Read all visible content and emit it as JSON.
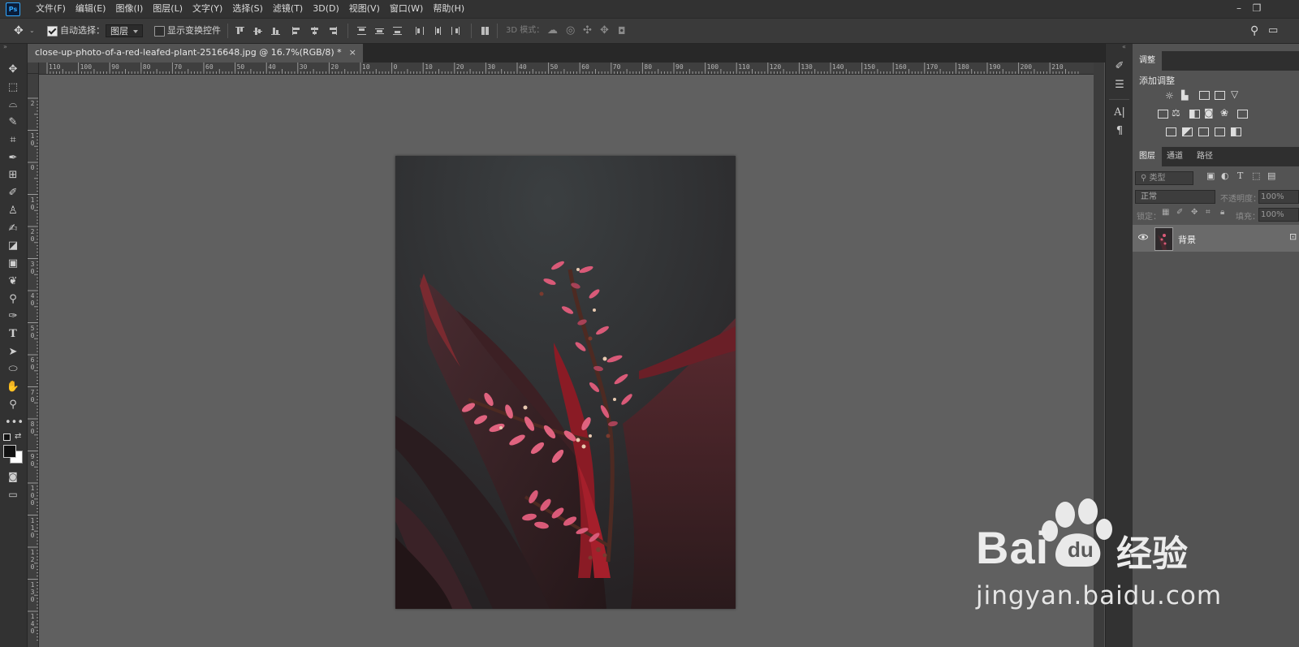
{
  "menubar": {
    "app_logo": "Ps",
    "items": [
      "文件(F)",
      "编辑(E)",
      "图像(I)",
      "图层(L)",
      "文字(Y)",
      "选择(S)",
      "滤镜(T)",
      "3D(D)",
      "视图(V)",
      "窗口(W)",
      "帮助(H)"
    ]
  },
  "options_bar": {
    "auto_select_label": "自动选择：",
    "auto_select_checked": true,
    "auto_select_target": "图层",
    "show_transform_label": "显示变换控件",
    "show_transform_checked": false,
    "mode_3d_label": "3D 模式："
  },
  "document": {
    "tab_title": "close-up-photo-of-a-red-leafed-plant-2516648.jpg @ 16.7%(RGB/8) *",
    "close_glyph": "×"
  },
  "rulers": {
    "horizontal": [
      "110",
      "100",
      "90",
      "80",
      "70",
      "60",
      "50",
      "40",
      "30",
      "20",
      "10",
      "0",
      "10",
      "20",
      "30",
      "40",
      "50",
      "60",
      "70",
      "80",
      "90",
      "100",
      "110",
      "120",
      "130",
      "140",
      "150",
      "160",
      "170",
      "180",
      "190",
      "200",
      "210"
    ],
    "vertical": [
      "2",
      "1\n0",
      "0",
      "1\n0",
      "2\n0",
      "3\n0",
      "4\n0",
      "5\n0",
      "6\n0",
      "7\n0",
      "8\n0",
      "9\n0",
      "1\n0\n0",
      "1\n1\n0",
      "1\n2\n0",
      "1\n3\n0",
      "1\n4\n0"
    ]
  },
  "adjustments_panel": {
    "tab": "调整",
    "title": "添加调整"
  },
  "layers_panel": {
    "tabs": [
      "图层",
      "通道",
      "路径"
    ],
    "filter_label": "类型",
    "blend_mode": "正常",
    "opacity_label": "不透明度：",
    "opacity_value": "100%",
    "lock_label": "锁定：",
    "fill_label": "填充：",
    "fill_value": "100%",
    "layers": [
      {
        "name": "背景",
        "visible": true,
        "locked": true
      }
    ]
  },
  "watermark": {
    "brand": "Bai",
    "brand_du": "du",
    "suffix": "经验",
    "url": "jingyan.baidu.com"
  },
  "colors": {
    "menubar_bg": "#323232",
    "panel_bg": "#535353",
    "canvas_bg": "#606060",
    "ps_blue": "#31a8ff"
  }
}
